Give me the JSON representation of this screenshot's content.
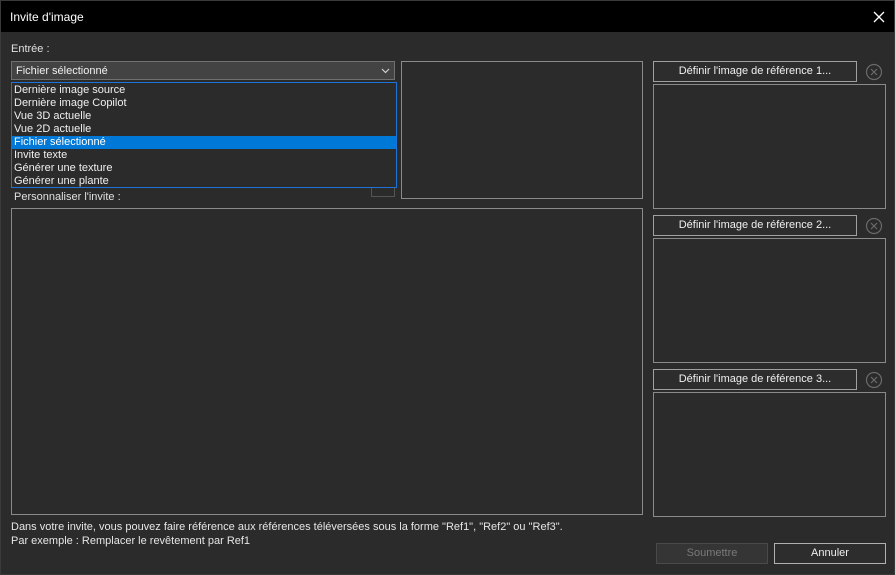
{
  "window": {
    "title": "Invite d'image"
  },
  "input": {
    "label": "Entrée :",
    "selected": "Fichier sélectionné",
    "options": [
      {
        "label": "Dernière image source",
        "selected": false
      },
      {
        "label": "Dernière image Copilot",
        "selected": false
      },
      {
        "label": "Vue 3D actuelle",
        "selected": false
      },
      {
        "label": "Vue 2D actuelle",
        "selected": false
      },
      {
        "label": "Fichier sélectionné",
        "selected": true
      },
      {
        "label": "Invite texte",
        "selected": false
      },
      {
        "label": "Générer une texture",
        "selected": false
      },
      {
        "label": "Générer une plante",
        "selected": false
      }
    ]
  },
  "prompt": {
    "label": "Personnaliser l'invite :",
    "value": ""
  },
  "references": [
    {
      "button_label": "Définir l'image de référence 1..."
    },
    {
      "button_label": "Définir l'image de référence 2..."
    },
    {
      "button_label": "Définir l'image de référence 3..."
    }
  ],
  "hints": {
    "line1": "Dans votre invite, vous pouvez faire référence aux références téléversées sous la forme \"Ref1\", \"Ref2\" ou \"Ref3\".",
    "line2": "Par exemple : Remplacer le revêtement par Ref1"
  },
  "actions": {
    "submit_label": "Soumettre",
    "cancel_label": "Annuler"
  },
  "colors": {
    "accent": "#0078d7",
    "background": "#2b2b2b",
    "titlebar": "#000000"
  }
}
